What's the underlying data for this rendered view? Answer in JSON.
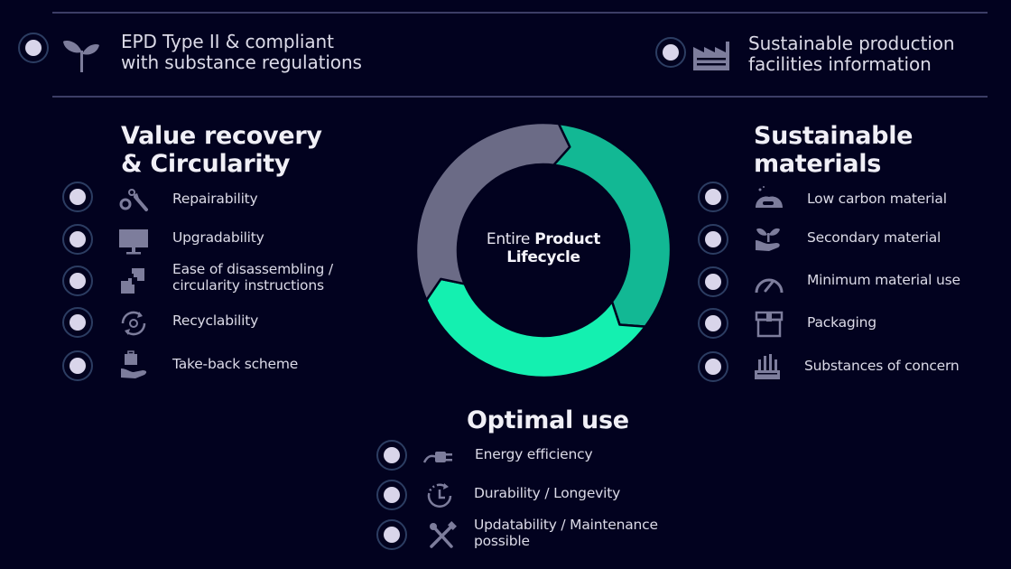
{
  "colors": {
    "background": "#02021f",
    "segment_value_recovery": "#6b6b86",
    "segment_sustainable_materials": "#12b894",
    "segment_optimal_use": "#14f0b0",
    "icon": "#7d7d9c",
    "text": "#dcdbe8"
  },
  "top_items": [
    {
      "icon": "sprout-icon",
      "label_line1": "EPD Type II & compliant",
      "label_line2": "with substance regulations"
    },
    {
      "icon": "factory-icon",
      "label_line1": "Sustainable production",
      "label_line2": "facilities information"
    }
  ],
  "center": {
    "label_regular": "Entire ",
    "label_bold_1": "Product",
    "label_bold_2": "Lifecycle"
  },
  "chart_data": {
    "type": "pie",
    "variant": "donut",
    "title": "Entire Product Lifecycle",
    "categories": [
      "Sustainable materials",
      "Optimal use",
      "Value recovery & Circularity"
    ],
    "values": [
      1,
      1,
      1
    ],
    "order": "clockwise from top"
  },
  "sections": {
    "value_recovery": {
      "title_line1": "Value recovery",
      "title_line2": "& Circularity",
      "items": [
        {
          "icon": "wrench-gear-icon",
          "label": "Repairability"
        },
        {
          "icon": "monitor-icon",
          "label": "Upgradability"
        },
        {
          "icon": "puzzle-icon",
          "label_line1": "Ease of disassembling /",
          "label_line2": "circularity instructions"
        },
        {
          "icon": "recycle-gear-icon",
          "label": "Recyclability"
        },
        {
          "icon": "hand-suitcase-icon",
          "label": "Take-back scheme"
        }
      ]
    },
    "sustainable_materials": {
      "title_line1": "Sustainable",
      "title_line2": "materials",
      "items": [
        {
          "icon": "co2-cloud-icon",
          "label": "Low carbon material"
        },
        {
          "icon": "hand-plant-icon",
          "label": "Secondary material"
        },
        {
          "icon": "gauge-icon",
          "label": "Minimum material use"
        },
        {
          "icon": "box-icon",
          "label": "Packaging"
        },
        {
          "icon": "chemical-plant-icon",
          "label": "Substances of concern"
        }
      ]
    },
    "optimal_use": {
      "title": "Optimal use",
      "items": [
        {
          "icon": "plug-icon",
          "label": "Energy efficiency"
        },
        {
          "icon": "clock-icon",
          "label": "Durability / Longevity"
        },
        {
          "icon": "tools-icon",
          "label_line1": "Updatability / Maintenance",
          "label_line2": "possible"
        }
      ]
    }
  }
}
